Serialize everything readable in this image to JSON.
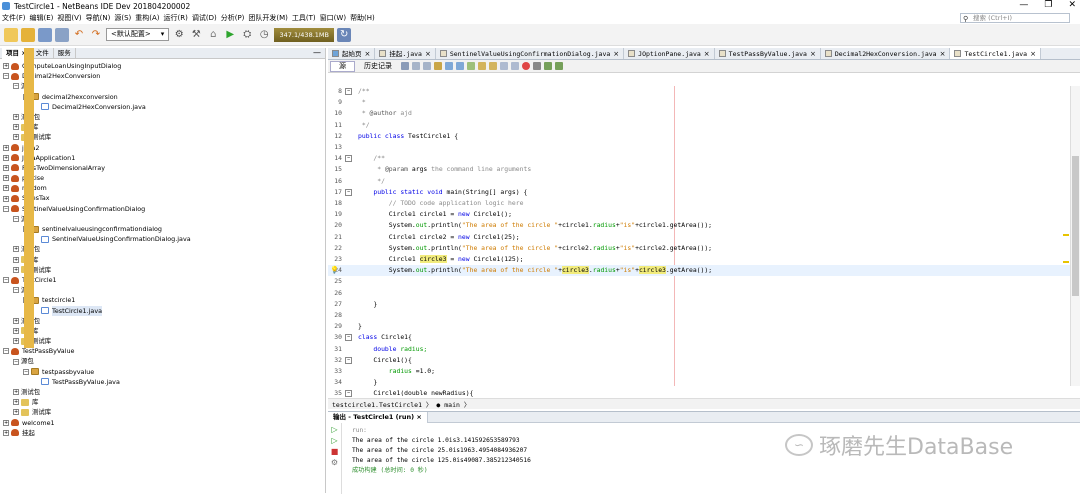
{
  "window": {
    "title": "TestCircle1 - NetBeans IDE Dev 201804200002",
    "controls": [
      "—",
      "❐",
      "✕"
    ]
  },
  "menu": [
    "文件(F)",
    "编辑(E)",
    "视图(V)",
    "导航(N)",
    "源(S)",
    "重构(A)",
    "运行(R)",
    "调试(D)",
    "分析(P)",
    "团队开发(M)",
    "工具(T)",
    "窗口(W)",
    "帮助(H)"
  ],
  "search": {
    "placeholder": "搜索 (Ctrl+I)"
  },
  "toolbar": {
    "config_combo": "<默认配置>",
    "memory": "347.1/438.1MB"
  },
  "left_panel": {
    "tabs": [
      "项目 ×",
      "文件",
      "服务"
    ],
    "minimize": "—",
    "tree": [
      {
        "depth": 0,
        "exp": "+",
        "icon": "proj",
        "label": "ComputeLoanUsingInputDialog"
      },
      {
        "depth": 0,
        "exp": "−",
        "icon": "proj",
        "label": "Decimal2HexConversion"
      },
      {
        "depth": 1,
        "exp": "−",
        "icon": "fold",
        "label": "源包"
      },
      {
        "depth": 2,
        "exp": "−",
        "icon": "pkg",
        "label": "decimal2hexconversion"
      },
      {
        "depth": 3,
        "exp": "",
        "icon": "java",
        "label": "Decimal2HexConversion.java"
      },
      {
        "depth": 1,
        "exp": "+",
        "icon": "fold",
        "label": "测试包"
      },
      {
        "depth": 1,
        "exp": "+",
        "icon": "lib",
        "label": "库"
      },
      {
        "depth": 1,
        "exp": "+",
        "icon": "lib",
        "label": "测试库"
      },
      {
        "depth": 0,
        "exp": "+",
        "icon": "proj",
        "label": "java2"
      },
      {
        "depth": 0,
        "exp": "+",
        "icon": "proj",
        "label": "JavaApplication1"
      },
      {
        "depth": 0,
        "exp": "+",
        "icon": "proj",
        "label": "PassTwoDimensionalArray"
      },
      {
        "depth": 0,
        "exp": "+",
        "icon": "proj",
        "label": "protise"
      },
      {
        "depth": 0,
        "exp": "+",
        "icon": "proj",
        "label": "random"
      },
      {
        "depth": 0,
        "exp": "+",
        "icon": "proj",
        "label": "SalesTax"
      },
      {
        "depth": 0,
        "exp": "−",
        "icon": "proj",
        "label": "SentinelValueUsingConfirmationDialog"
      },
      {
        "depth": 1,
        "exp": "−",
        "icon": "fold",
        "label": "源包"
      },
      {
        "depth": 2,
        "exp": "−",
        "icon": "pkg",
        "label": "sentinelvalueusingconfirmationdialog"
      },
      {
        "depth": 3,
        "exp": "",
        "icon": "java",
        "label": "SentinelValueUsingConfirmationDialog.java"
      },
      {
        "depth": 1,
        "exp": "+",
        "icon": "fold",
        "label": "测试包"
      },
      {
        "depth": 1,
        "exp": "+",
        "icon": "lib",
        "label": "库"
      },
      {
        "depth": 1,
        "exp": "+",
        "icon": "lib",
        "label": "测试库"
      },
      {
        "depth": 0,
        "exp": "−",
        "icon": "proj",
        "label": "TestCircle1"
      },
      {
        "depth": 1,
        "exp": "−",
        "icon": "fold",
        "label": "源包"
      },
      {
        "depth": 2,
        "exp": "−",
        "icon": "pkg",
        "label": "testcircle1"
      },
      {
        "depth": 3,
        "exp": "",
        "icon": "java",
        "label": "TestCircle1.java",
        "selected": true
      },
      {
        "depth": 1,
        "exp": "+",
        "icon": "fold",
        "label": "测试包"
      },
      {
        "depth": 1,
        "exp": "+",
        "icon": "lib",
        "label": "库"
      },
      {
        "depth": 1,
        "exp": "+",
        "icon": "lib",
        "label": "测试库"
      },
      {
        "depth": 0,
        "exp": "−",
        "icon": "proj",
        "label": "TestPassByValue"
      },
      {
        "depth": 1,
        "exp": "−",
        "icon": "fold",
        "label": "源包"
      },
      {
        "depth": 2,
        "exp": "−",
        "icon": "pkg",
        "label": "testpassbyvalue"
      },
      {
        "depth": 3,
        "exp": "",
        "icon": "java",
        "label": "TestPassByValue.java"
      },
      {
        "depth": 1,
        "exp": "+",
        "icon": "fold",
        "label": "测试包"
      },
      {
        "depth": 1,
        "exp": "+",
        "icon": "lib",
        "label": "库"
      },
      {
        "depth": 1,
        "exp": "+",
        "icon": "lib",
        "label": "测试库"
      },
      {
        "depth": 0,
        "exp": "+",
        "icon": "proj",
        "label": "welcome1"
      },
      {
        "depth": 0,
        "exp": "+",
        "icon": "proj",
        "label": "挂起"
      }
    ]
  },
  "editor": {
    "tabs": [
      {
        "label": "起始页",
        "close": "×"
      },
      {
        "label": "挂起.java",
        "close": "×"
      },
      {
        "label": "SentinelValueUsingConfirmationDialog.java",
        "close": "×"
      },
      {
        "label": "JOptionPane.java",
        "close": "×"
      },
      {
        "label": "TestPassByValue.java",
        "close": "×"
      },
      {
        "label": "Decimal2HexConversion.java",
        "close": "×"
      },
      {
        "label": "TestCircle1.java",
        "close": "×",
        "active": true
      }
    ],
    "subtabs": [
      "源",
      "历史记录"
    ],
    "lines": [
      {
        "n": "8",
        "fold": "−",
        "segs": [
          {
            "t": "/**",
            "c": "cm"
          }
        ]
      },
      {
        "n": "9",
        "segs": [
          {
            "t": " *",
            "c": "cm"
          }
        ]
      },
      {
        "n": "10",
        "segs": [
          {
            "t": " * ",
            "c": "cm"
          },
          {
            "t": "@author",
            "c": "ann"
          },
          {
            "t": " ajd",
            "c": "cm"
          }
        ]
      },
      {
        "n": "11",
        "segs": [
          {
            "t": " */",
            "c": "cm"
          }
        ]
      },
      {
        "n": "12",
        "segs": [
          {
            "t": "public class ",
            "c": "kw"
          },
          {
            "t": "TestCircle1 {",
            "c": ""
          }
        ]
      },
      {
        "n": "13",
        "segs": []
      },
      {
        "n": "14",
        "fold": "−",
        "segs": [
          {
            "t": "    /**",
            "c": "cm"
          }
        ]
      },
      {
        "n": "15",
        "segs": [
          {
            "t": "     * ",
            "c": "cm"
          },
          {
            "t": "@param",
            "c": "ann"
          },
          {
            "t": " args",
            "c": ""
          },
          {
            "t": " the command line arguments",
            "c": "cm"
          }
        ]
      },
      {
        "n": "16",
        "segs": [
          {
            "t": "     */",
            "c": "cm"
          }
        ]
      },
      {
        "n": "17",
        "fold": "−",
        "segs": [
          {
            "t": "    public static void ",
            "c": "kw"
          },
          {
            "t": "main(String[] args) {",
            "c": ""
          }
        ]
      },
      {
        "n": "18",
        "segs": [
          {
            "t": "        // TODO code application logic here",
            "c": "cm"
          }
        ]
      },
      {
        "n": "19",
        "segs": [
          {
            "t": "        Circle1 circle1 = ",
            "c": ""
          },
          {
            "t": "new ",
            "c": "kw"
          },
          {
            "t": "Circle1();",
            "c": ""
          }
        ]
      },
      {
        "n": "20",
        "segs": [
          {
            "t": "        System.",
            "c": ""
          },
          {
            "t": "out",
            "c": "fld"
          },
          {
            "t": ".println(",
            "c": ""
          },
          {
            "t": "\"The area of the circle \"",
            "c": "str"
          },
          {
            "t": "+circle1.",
            "c": ""
          },
          {
            "t": "radius",
            "c": "fld"
          },
          {
            "t": "+",
            "c": ""
          },
          {
            "t": "\"is\"",
            "c": "str"
          },
          {
            "t": "+circle1.getArea());",
            "c": ""
          }
        ]
      },
      {
        "n": "21",
        "segs": [
          {
            "t": "        Circle1 circle2 = ",
            "c": ""
          },
          {
            "t": "new ",
            "c": "kw"
          },
          {
            "t": "Circle1(25);",
            "c": ""
          }
        ]
      },
      {
        "n": "22",
        "segs": [
          {
            "t": "        System.",
            "c": ""
          },
          {
            "t": "out",
            "c": "fld"
          },
          {
            "t": ".println(",
            "c": ""
          },
          {
            "t": "\"The area of the circle \"",
            "c": "str"
          },
          {
            "t": "+circle2.",
            "c": ""
          },
          {
            "t": "radius",
            "c": "fld"
          },
          {
            "t": "+",
            "c": ""
          },
          {
            "t": "\"is\"",
            "c": "str"
          },
          {
            "t": "+circle2.getArea());",
            "c": ""
          }
        ]
      },
      {
        "n": "23",
        "segs": [
          {
            "t": "        Circle1 ",
            "c": ""
          },
          {
            "t": "circle3",
            "c": "hl"
          },
          {
            "t": " = ",
            "c": ""
          },
          {
            "t": "new ",
            "c": "kw"
          },
          {
            "t": "Circle1(125);",
            "c": ""
          }
        ]
      },
      {
        "n": "24",
        "cur": true,
        "bulb": "💡",
        "segs": [
          {
            "t": "        System.",
            "c": ""
          },
          {
            "t": "out",
            "c": "fld"
          },
          {
            "t": ".println(",
            "c": ""
          },
          {
            "t": "\"The area of the circle \"",
            "c": "str"
          },
          {
            "t": "+",
            "c": ""
          },
          {
            "t": "circle3",
            "c": "hl"
          },
          {
            "t": ".",
            "c": ""
          },
          {
            "t": "radius",
            "c": "fld"
          },
          {
            "t": "+",
            "c": ""
          },
          {
            "t": "\"is\"",
            "c": "str"
          },
          {
            "t": "+",
            "c": ""
          },
          {
            "t": "circle3",
            "c": "hl"
          },
          {
            "t": ".getArea());",
            "c": ""
          }
        ]
      },
      {
        "n": "25",
        "segs": []
      },
      {
        "n": "26",
        "segs": []
      },
      {
        "n": "27",
        "segs": [
          {
            "t": "    }",
            "c": ""
          }
        ]
      },
      {
        "n": "28",
        "segs": []
      },
      {
        "n": "29",
        "segs": [
          {
            "t": "}",
            "c": ""
          }
        ]
      },
      {
        "n": "30",
        "fold": "−",
        "segs": [
          {
            "t": "class ",
            "c": "kw"
          },
          {
            "t": "Circle1{",
            "c": ""
          }
        ]
      },
      {
        "n": "31",
        "segs": [
          {
            "t": "    double ",
            "c": "kw"
          },
          {
            "t": "radius;",
            "c": "fld"
          }
        ]
      },
      {
        "n": "32",
        "fold": "−",
        "segs": [
          {
            "t": "    Circle1(){",
            "c": ""
          }
        ]
      },
      {
        "n": "33",
        "segs": [
          {
            "t": "        ",
            "c": ""
          },
          {
            "t": "radius",
            "c": "fld"
          },
          {
            "t": " =1.0;",
            "c": ""
          }
        ]
      },
      {
        "n": "34",
        "segs": [
          {
            "t": "    }",
            "c": ""
          }
        ]
      },
      {
        "n": "35",
        "fold": "−",
        "segs": [
          {
            "t": "    Circle1(double newRadius){",
            "c": ""
          }
        ]
      }
    ],
    "breadcrumb": [
      "testcircle1.TestCircle1 〉",
      "● main 〉"
    ]
  },
  "output": {
    "tab": "输出 - TestCircle1 (run) ×",
    "lines": [
      {
        "t": "run:",
        "c": "ogray"
      },
      {
        "t": "The area of the circle 1.0is3.141592653589793",
        "c": ""
      },
      {
        "t": "The area of the circle 25.0is1963.4954084936207",
        "c": ""
      },
      {
        "t": "The area of the circle 125.0is49087.385212340516",
        "c": ""
      },
      {
        "t": "成功构建 (总时间: 0 秒)",
        "c": "ogreen"
      }
    ]
  },
  "watermark": {
    "text": "琢磨先生DataBase"
  }
}
